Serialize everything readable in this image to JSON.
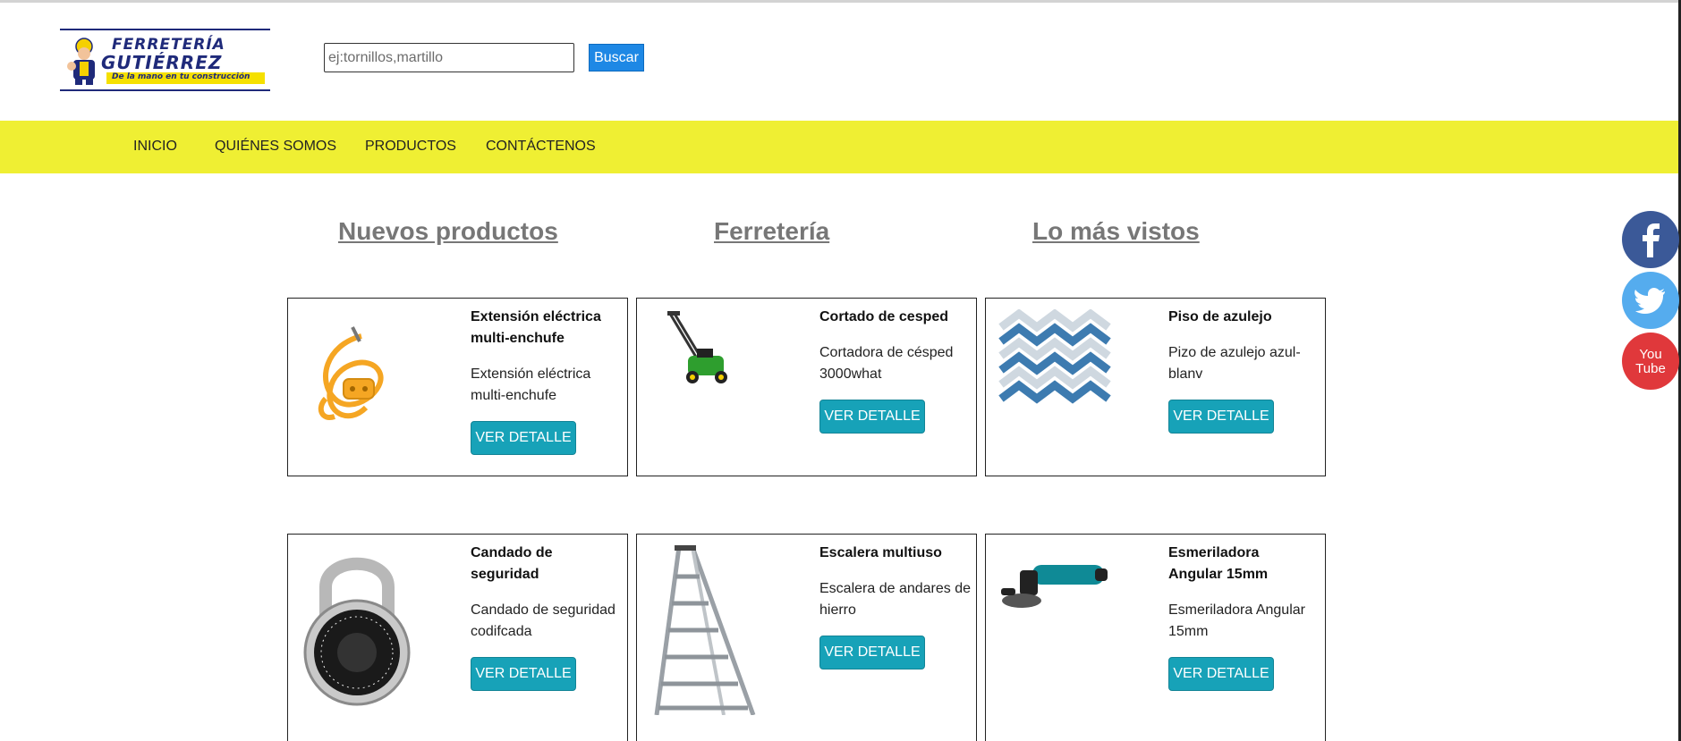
{
  "logo": {
    "line1": "FERRETERÍA",
    "line2": "GUTIÉRREZ",
    "slogan": "De la mano en tu construcción"
  },
  "search": {
    "placeholder": "ej:tornillos,martillo",
    "button_label": "Buscar"
  },
  "nav": {
    "items": [
      "INICIO",
      "QUIÉNES SOMOS",
      "PRODUCTOS",
      "CONTÁCTENOS"
    ]
  },
  "sections": {
    "headings": [
      "Nuevos productos",
      "Ferretería",
      "Lo más vistos"
    ]
  },
  "products": [
    {
      "title": "Extensión eléctrica multi-enchufe",
      "description": "Extensión eléctrica multi-enchufe",
      "button": "VER DETALLE",
      "image": "orange-extension-cord"
    },
    {
      "title": "Cortado de cesped",
      "description": "Cortadora de césped 3000what",
      "button": "VER DETALLE",
      "image": "green-lawn-mower"
    },
    {
      "title": "Piso de azulejo",
      "description": "Pizo de azulejo azul-blanv",
      "button": "VER DETALLE",
      "image": "blue-white-tile"
    },
    {
      "title": "Candado de seguridad",
      "description": "Candado de seguridad codifcada",
      "button": "VER DETALLE",
      "image": "combination-padlock"
    },
    {
      "title": "Escalera multiuso",
      "description": "Escalera de andares de hierro",
      "button": "VER DETALLE",
      "image": "aluminum-ladder"
    },
    {
      "title": "Esmeriladora Angular 15mm",
      "description": "Esmeriladora Angular 15mm",
      "button": "VER DETALLE",
      "image": "angle-grinder"
    }
  ],
  "social": {
    "icons": [
      "facebook-icon",
      "twitter-icon",
      "youtube-icon"
    ],
    "youtube_text": [
      "You",
      "Tube"
    ],
    "colors": {
      "facebook": "#3b5998",
      "twitter": "#55acee",
      "youtube": "#e0383b"
    }
  },
  "colors": {
    "navbar": "#efef33",
    "button_primary": "#17a2b8",
    "search_button": "#1e88e5",
    "heading": "#777777"
  }
}
